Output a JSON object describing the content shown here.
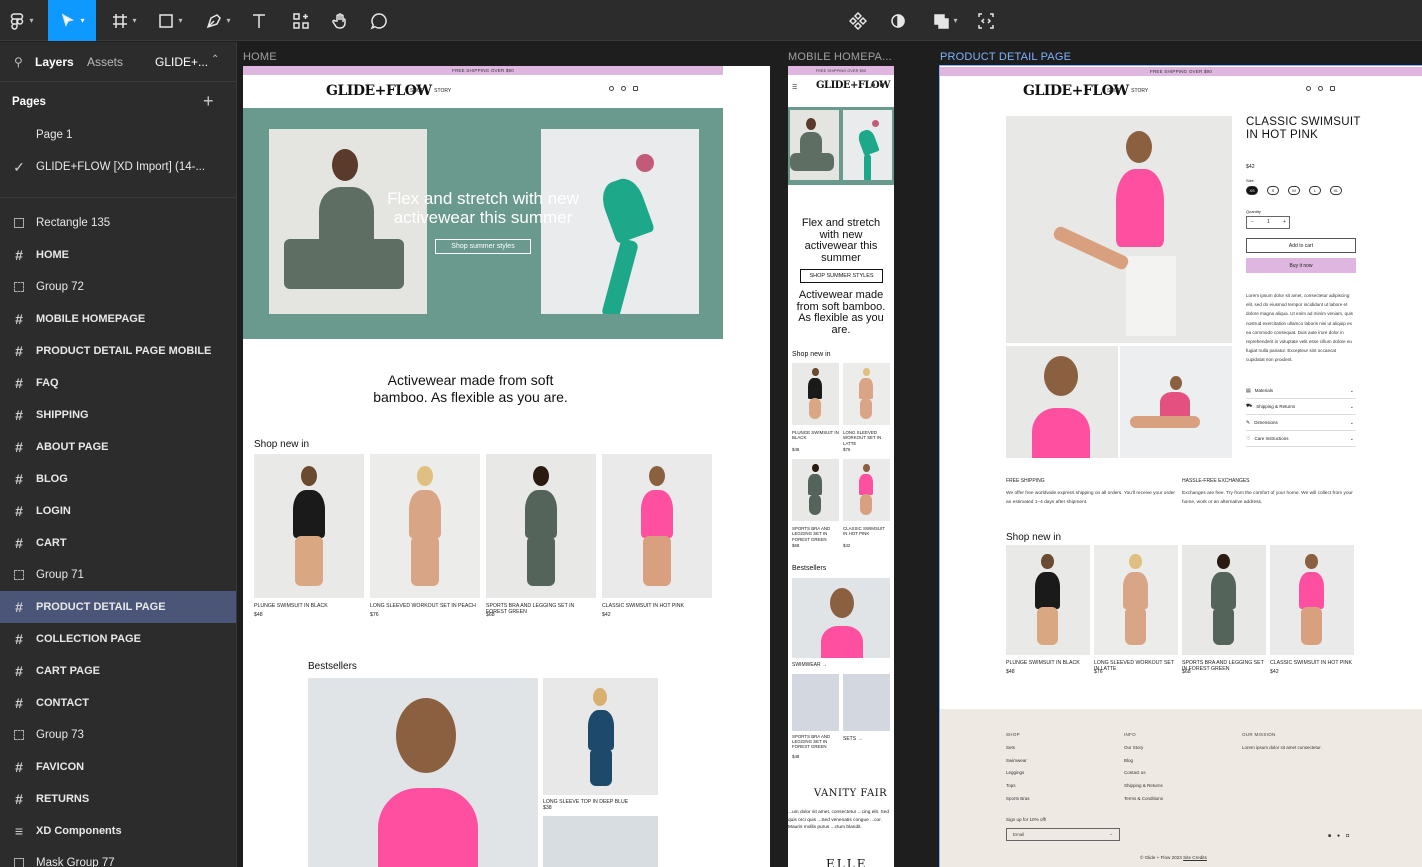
{
  "toolbar": {
    "code_icon_label": "</>"
  },
  "sidebar": {
    "tabs": {
      "layers": "Layers",
      "assets": "Assets",
      "page_name": "GLIDE+..."
    },
    "pages_title": "Pages",
    "pages": [
      {
        "label": "Page 1"
      },
      {
        "label": "GLIDE+FLOW  [XD Import] (14-..."
      }
    ],
    "layers": [
      {
        "label": "Rectangle 135"
      },
      {
        "label": "HOME"
      },
      {
        "label": "Group 72"
      },
      {
        "label": "MOBILE HOMEPAGE"
      },
      {
        "label": "PRODUCT DETAIL PAGE MOBILE"
      },
      {
        "label": "FAQ"
      },
      {
        "label": "SHIPPING"
      },
      {
        "label": "ABOUT PAGE"
      },
      {
        "label": "BLOG"
      },
      {
        "label": "LOGIN"
      },
      {
        "label": "CART"
      },
      {
        "label": "Group 71"
      },
      {
        "label": "PRODUCT DETAIL PAGE"
      },
      {
        "label": "COLLECTION PAGE"
      },
      {
        "label": "CART PAGE"
      },
      {
        "label": "CONTACT"
      },
      {
        "label": "Group 73"
      },
      {
        "label": "FAVICON"
      },
      {
        "label": "RETURNS"
      },
      {
        "label": "XD Components"
      },
      {
        "label": "Mask Group 77"
      }
    ]
  },
  "frames": {
    "home": "HOME",
    "mobile": "MOBILE HOMEPA...",
    "pdp": "PRODUCT DETAIL PAGE"
  },
  "site": {
    "banner": "FREE SHIPPING OVER $90",
    "logo": "GLIDE+FLOW",
    "nav_shop": "SHOP",
    "nav_story": "STORY"
  },
  "home": {
    "hero_title": "Flex and stretch with new activewear this summer",
    "hero_button": "Shop summer styles",
    "tagline": "Activewear made from soft bamboo. As flexible as you are.",
    "shop_new": "Shop new in",
    "products": [
      {
        "name": "PLUNGE SWIMSUIT IN BLACK",
        "price": "$48"
      },
      {
        "name": "LONG SLEEVED WORKOUT SET IN PEACH",
        "price": "$76"
      },
      {
        "name": "SPORTS BRA AND LEGGING SET IN FOREST GREEN",
        "price": "$68"
      },
      {
        "name": "CLASSIC SWIMSUIT IN HOT PINK",
        "price": "$42"
      }
    ],
    "bestsellers": "Bestsellers",
    "best_item": "LONG SLEEVE TOP IN DEEP BLUE",
    "best_price": "$38"
  },
  "mobile": {
    "hero_title": "Flex and stretch with new activewear this summer",
    "hero_button": "SHOP SUMMER STYLES",
    "tagline": "Activewear made from soft bamboo. As flexible as you are.",
    "shop_new": "Shop new in",
    "products": [
      {
        "name": "PLUNGE SWIMSUIT IN BLACK",
        "price": "$48"
      },
      {
        "name": "LONG SLEEVED WORKOUT SET IN LATTE",
        "price": "$76"
      },
      {
        "name": "SPORTS BRA AND LEGGING SET IN FOREST GREEN",
        "price": "$68"
      },
      {
        "name": "CLASSIC SWIMSUIT IN HOT PINK",
        "price": "$42"
      }
    ],
    "bestsellers": "Bestsellers",
    "swimwear": "SWIMWEAR →",
    "card1": "SPORTS BRA AND LEGGING SET IN FOREST GREEN",
    "card1_price": "$48",
    "sets": "SETS  →",
    "press1": "VANITY FAIR",
    "quote": "...um dolor sit amet, consectetur ...cing elit. Sed quis orci quis ...Sed venenatis congue ...cor. Mauris mollis purus ...ctum blandit.",
    "press2": "ELLE"
  },
  "pdp": {
    "title": "CLASSIC SWIMSUIT IN HOT PINK",
    "price": "$42",
    "size_label": "Size",
    "sizes": [
      "XS",
      "S",
      "M",
      "L",
      "XL"
    ],
    "qty_label": "Quantity",
    "qty_minus": "−",
    "qty_value": "1",
    "qty_plus": "+",
    "add_to_cart": "Add to cart",
    "buy_now": "Buy it now",
    "description": "Lorem ipsum dolor sit amet, consectetur adipiscing elit, sed do eiusmod tempor incididunt ut labore et dolore magna aliqua. Ut enim ad minim veniam, quis nostrud exercitation ullamco laboris nisi ut aliquip ex ea commodo consequat. Duis aute irure dolor in reprehenderit in voluptate velit esse cillum dolore eu fugiat nulla pariatur. Excepteur sint occaecat cupidatat non proident.",
    "accordion": [
      "Materials",
      "Shipping & Returns",
      "Dimensions",
      "Care Instructions"
    ],
    "ship_title": "FREE SHIPPING",
    "ship_text": "We offer free worldwide express shipping on all orders. You'll receive your order an estimated 1–4 days after shipment.",
    "ex_title": "HASSLE-FREE EXCHANGES",
    "ex_text": "Exchanges are free. Try from the comfort of your home. We will collect from your home, work or an alternative address.",
    "shop_new": "Shop new in",
    "products": [
      {
        "name": "PLUNGE SWIMSUIT IN BLACK",
        "price": "$48"
      },
      {
        "name": "LONG SLEEVED WORKOUT SET IN LATTE",
        "price": "$76"
      },
      {
        "name": "SPORTS BRA AND LEGGING SET IN FOREST GREEN",
        "price": "$68"
      },
      {
        "name": "CLASSIC SWIMSUIT IN HOT PINK",
        "price": "$42"
      }
    ],
    "footer": {
      "shop_h": "SHOP",
      "shop": [
        "Sets",
        "Swimwear",
        "Leggings",
        "Tops",
        "Sports Bras"
      ],
      "info_h": "INFO",
      "info": [
        "Our Story",
        "Blog",
        "Contact us",
        "Shipping & Returns",
        "Terms & Conditions"
      ],
      "mission_h": "OUR MISSION",
      "mission": "Lorem ipsum dolor sit amet consectetur.",
      "signup": "Sign up for 10% off!",
      "email": "Email",
      "arrow": "→",
      "copyright": "© Glide + Flow 2023",
      "credits": "Site Credits"
    }
  },
  "colors": {
    "accent": "#4a5578",
    "hero": "#6a9a8e",
    "pink": "#ff4fa0",
    "banner": "#dfb6df",
    "footer": "#eee9e3"
  }
}
